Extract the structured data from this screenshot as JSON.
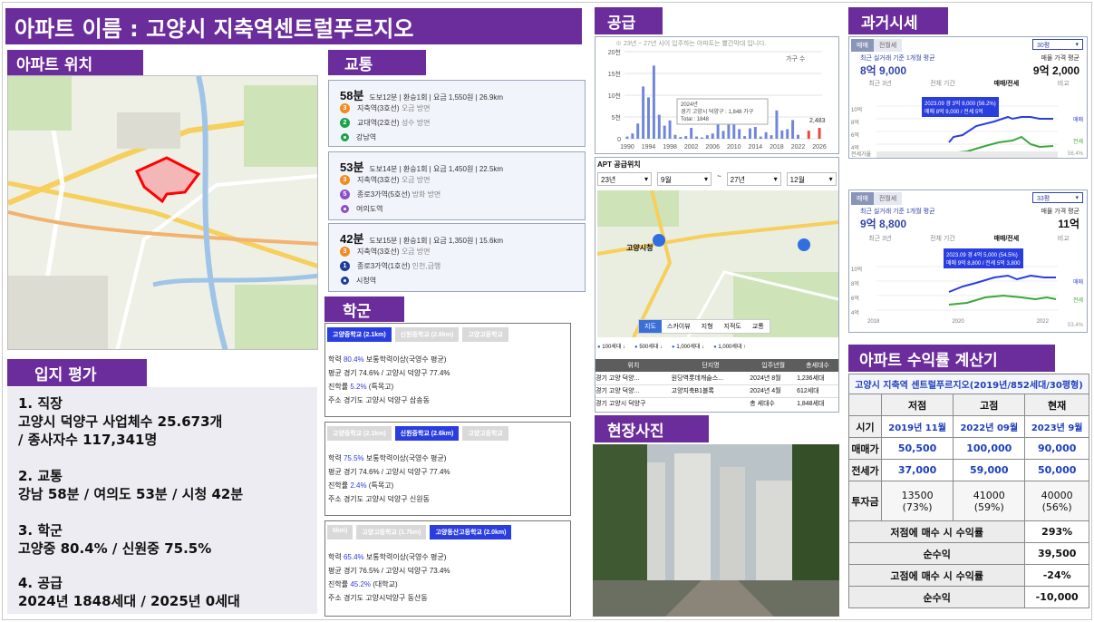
{
  "title": "아파트 이름 : 고양시 지축역센트럴푸르지오",
  "sections": {
    "location": "아파트 위치",
    "transport": "교통",
    "school": "학군",
    "supply": "공급",
    "history": "과거시세",
    "photo": "현장사진",
    "calc": "아파트 수익률 계산기",
    "evaluation": "입지 평가"
  },
  "transport": [
    {
      "time": "58분",
      "info": "도보12분 | 환승1회 | 요금 1,550원 | 26.9km",
      "stations": [
        {
          "num": "3",
          "color": "#f28b22",
          "name": "지축역(3호선)",
          "dir": "오금 방면"
        },
        {
          "num": "2",
          "color": "#1aa34a",
          "name": "교대역(2호선)",
          "dir": "성수 방면"
        },
        {
          "num": "",
          "color": "#1aa34a",
          "name": "강남역",
          "dir": ""
        }
      ]
    },
    {
      "time": "53분",
      "info": "도보14분 | 환승1회 | 요금 1,450원 | 22.5km",
      "stations": [
        {
          "num": "3",
          "color": "#f28b22",
          "name": "지축역(3호선)",
          "dir": "오금 방면"
        },
        {
          "num": "5",
          "color": "#8b4fc9",
          "name": "종로3가역(5호선)",
          "dir": "방화 방면"
        },
        {
          "num": "",
          "color": "#8b4fc9",
          "name": "여의도역",
          "dir": ""
        }
      ]
    },
    {
      "time": "42분",
      "info": "도보15분 | 환승1회 | 요금 1,350원 | 15.6km",
      "stations": [
        {
          "num": "3",
          "color": "#f28b22",
          "name": "지축역(3호선)",
          "dir": "오금 방면"
        },
        {
          "num": "1",
          "color": "#1c3c9e",
          "name": "종로3가역(1호선)",
          "dir": "인천,급행"
        },
        {
          "num": "",
          "color": "#1c3c9e",
          "name": "시청역",
          "dir": ""
        }
      ]
    }
  ],
  "schools": [
    {
      "tabs": [
        "고양중학교 (2.1km)",
        "신원중학교 (2.6km)",
        "고양고등학교"
      ],
      "active": 0,
      "rate": "80.4%",
      "rate_label": "보통학력이상(국영수 평균)",
      "avg": "평균 경기 74.6% / 고양시 덕양구 77.4%",
      "adv_label": "진학률",
      "adv": "5.2%",
      "adv_type": "(특목고)",
      "addr": "주소 경기도 고양시 덕양구 삼송동"
    },
    {
      "tabs": [
        "고양중학교 (2.1km)",
        "신원중학교 (2.6km)",
        "고양고등학교"
      ],
      "active": 1,
      "rate": "75.5%",
      "rate_label": "보통학력이상(국영수 평균)",
      "avg": "평균 경기 74.6% / 고양시 덕양구 77.4%",
      "adv_label": "진학률",
      "adv": "2.4%",
      "adv_type": "(특목고)",
      "addr": "주소 경기도 고양시 덕양구 신원동"
    },
    {
      "tabs": [
        "6km)",
        "고양고등학교 (1.7km)",
        "고양동산고등학교 (2.0km)"
      ],
      "active": 2,
      "rate": "65.4%",
      "rate_label": "보통학력이상(국영수 평균)",
      "avg": "평균 경기 76.5% / 고양시 덕양구 73.4%",
      "adv_label": "진학률",
      "adv": "45.2%",
      "adv_type": "(대학교)",
      "addr": "주소 경기도 고양시덕양구 동산동"
    }
  ],
  "evaluation": [
    {
      "head": "1. 직장",
      "lines": [
        "고양시 덕양구 사업체수 25.673개",
        "/ 종사자수 117,341명"
      ]
    },
    {
      "head": "2. 교통",
      "lines": [
        "강남 58분 / 여의도 53분 / 시청 42분"
      ]
    },
    {
      "head": "3. 학군",
      "lines": [
        "고양중 80.4% / 신원중 75.5%"
      ]
    },
    {
      "head": "4. 공급",
      "lines": [
        "2024년 1848세대 / 2025년 0세대"
      ]
    }
  ],
  "supply": {
    "note": "※ 23년 ~ 27년 사이 입주하는 아파트는 빨간막대 입니다.",
    "legend": "가구 수",
    "tooltip": [
      "2024년",
      "경기 고양시 덕양구 : 1,848 가구",
      "Total : 1848"
    ],
    "last_label": "2,483",
    "apt_title": "APT 공급위치",
    "selects": [
      "23년",
      "9월",
      "27년",
      "12월"
    ],
    "map_tabs": [
      "지도",
      "스카이뷰",
      "지형",
      "지적도",
      "교통"
    ],
    "legend_icons": [
      "100세대 ↓",
      "500세대 ↓",
      "1,000세대 ↓",
      "1,000세대 ↑"
    ],
    "table_head": [
      "위치",
      "단지명",
      "입주년월",
      "총세대수"
    ],
    "table_rows": [
      [
        "경기 고양 덕양...",
        "원당역롯데캐슬스...",
        "2024년 8월",
        "1,236세대"
      ],
      [
        "경기 고양 덕양...",
        "고양지축B1블록",
        "2024년 4월",
        "612세대"
      ],
      [
        "경기 고양시 덕양구",
        "",
        "총 세대수",
        "1,848세대"
      ]
    ],
    "map_label": "고양시청"
  },
  "chart_data": {
    "type": "bar",
    "title": "",
    "xlabel": "",
    "ylabel": "",
    "ylim": [
      0,
      20000
    ],
    "yticks": [
      "0",
      "5천",
      "10천",
      "15천",
      "20천"
    ],
    "xticks": [
      "1990",
      "1994",
      "1998",
      "2002",
      "2006",
      "2010",
      "2014",
      "2018",
      "2022",
      "2026"
    ],
    "categories": [
      "1990",
      "1991",
      "1992",
      "1993",
      "1994",
      "1995",
      "1996",
      "1997",
      "1998",
      "1999",
      "2000",
      "2001",
      "2002",
      "2003",
      "2004",
      "2005",
      "2006",
      "2007",
      "2008",
      "2009",
      "2010",
      "2011",
      "2012",
      "2013",
      "2014",
      "2015",
      "2016",
      "2017",
      "2018",
      "2019",
      "2020",
      "2021",
      "2022",
      "2023",
      "2024",
      "2025",
      "2026"
    ],
    "values": [
      500,
      1200,
      3500,
      12000,
      9500,
      16800,
      5500,
      3000,
      4200,
      900,
      400,
      600,
      2500,
      500,
      300,
      800,
      1200,
      4000,
      1800,
      3600,
      5000,
      2200,
      600,
      2400,
      2700,
      500,
      1500,
      800,
      6500,
      1900,
      2200,
      4300,
      900,
      0,
      1848,
      0,
      2483
    ],
    "highlight": [
      "2024"
    ]
  },
  "history": [
    {
      "tabs": [
        "매매",
        "전월세"
      ],
      "size": "30평",
      "basis": "최근 실거래 기준 1개월 평균",
      "price": "8억 9,000",
      "ask_label": "매물 가격 평균",
      "ask": "9억 2,000",
      "sub_tabs": [
        "최근 3년",
        "전체 기간",
        "매매/전세",
        "비교"
      ],
      "tip1": "2023.09 경 3억 9,000 (56.2%)",
      "tip2": "매매 8억 9,000 / 전세 5억",
      "yticks": [
        "10억",
        "8억",
        "6억",
        "4억",
        "2억"
      ],
      "xticks": [
        "2018",
        "2020",
        "2022"
      ],
      "legend": [
        "매매",
        "전세"
      ],
      "foot": "전세가율",
      "pct": "56.4%"
    },
    {
      "tabs": [
        "매매",
        "전월세"
      ],
      "size": "33평",
      "basis": "최근 실거래 기준 1개월 평균",
      "price": "9억 8,800",
      "ask_label": "매물 가격 평균",
      "ask": "11억",
      "sub_tabs": [
        "최근 3년",
        "전체 기간",
        "매매/전세",
        "비교"
      ],
      "tip1": "2023.09 경 4억 5,000 (54.5%)",
      "tip2": "매매 9억 8,800 / 전세 5억 3,800",
      "yticks": [
        "10억",
        "8억",
        "6억",
        "4억",
        "2억"
      ],
      "xticks": [
        "2018",
        "2020",
        "2022"
      ],
      "legend": [
        "매매",
        "전세"
      ],
      "foot": "전세가율",
      "pct": "53.4%"
    }
  ],
  "calc": {
    "header": "고양시 지축역 센트럴푸르지오(2019년/852세대/30평형)",
    "cols": [
      "",
      "저점",
      "고점",
      "현재"
    ],
    "rows": [
      [
        "시기",
        "2019년 11월",
        "2022년 09월",
        "2023년 9월"
      ],
      [
        "매매가",
        "50,500",
        "100,000",
        "90,000"
      ],
      [
        "전세가",
        "37,000",
        "59,000",
        "50,000"
      ]
    ],
    "gap_label": "투자금",
    "gap": [
      [
        "13500",
        "(73%)"
      ],
      [
        "41000",
        "(59%)"
      ],
      [
        "40000",
        "(56%)"
      ]
    ],
    "summary": [
      [
        "저점에 매수 시 수익률",
        "293%"
      ],
      [
        "순수익",
        "39,500"
      ],
      [
        "고점에 매수 시 수익률",
        "-24%"
      ],
      [
        "순수익",
        "-10,000"
      ]
    ]
  }
}
